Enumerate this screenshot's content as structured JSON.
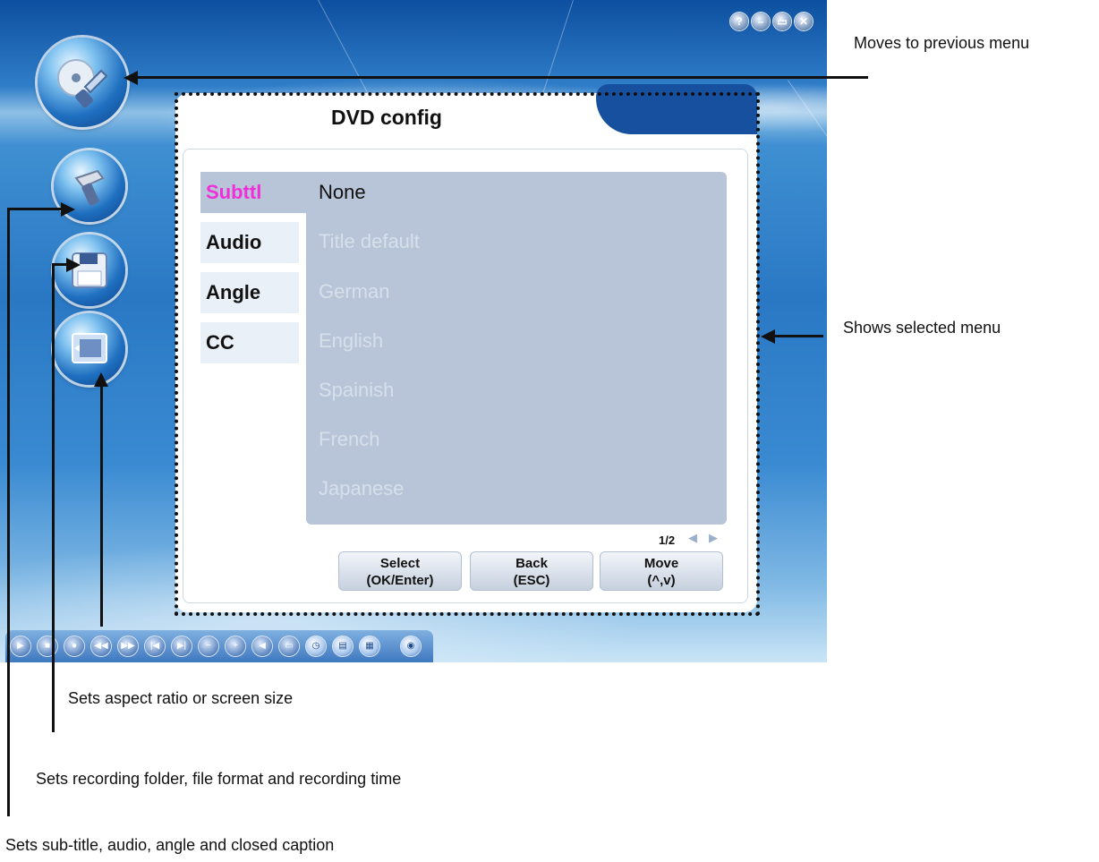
{
  "window_controls": {
    "help": "?",
    "minimize": "–",
    "restore": "▭",
    "close": "✕"
  },
  "dialog": {
    "title": "DVD config",
    "categories": [
      {
        "label": "Subttl",
        "selected": true
      },
      {
        "label": "Audio",
        "selected": false
      },
      {
        "label": "Angle",
        "selected": false
      },
      {
        "label": "CC",
        "selected": false
      }
    ],
    "options": [
      "None",
      "Title default",
      "German",
      "English",
      "Spainish",
      "French",
      "Japanese"
    ],
    "current_option": "None",
    "page": "1/2",
    "buttons": {
      "select_line1": "Select",
      "select_line2": "(OK/Enter)",
      "back_line1": "Back",
      "back_line2": "(ESC)",
      "move_line1": "Move",
      "move_line2": "(^,v)"
    }
  },
  "annotations": {
    "previous_menu": "Moves to previous menu",
    "selected_menu": "Shows selected menu",
    "aspect_ratio": "Sets aspect ratio or screen size",
    "recording": "Sets recording folder, file format and recording time",
    "subtitle_audio": "Sets sub-title, audio, angle and closed caption"
  },
  "colors": {
    "selected_category": "#f02fd8",
    "dialog_tab": "#16509e",
    "panel": "#b8c5d8"
  },
  "toolbar_icons": [
    "play-icon",
    "stop-icon",
    "record-icon",
    "rewind-icon",
    "forward-icon",
    "prev-icon",
    "next-icon",
    "volume-down-icon",
    "volume-up-icon",
    "mute-icon",
    "screen-icon",
    "timer-icon",
    "folder-icon",
    "keyboard-icon",
    "settings-icon"
  ]
}
